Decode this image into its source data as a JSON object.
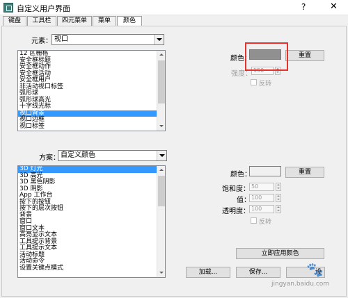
{
  "window": {
    "title": "自定义用户界面",
    "help": "?",
    "close": "✕"
  },
  "tabs": [
    "键盘",
    "工具栏",
    "四元菜单",
    "菜单",
    "颜色"
  ],
  "element_section": {
    "label": "元素：",
    "selected": "视口",
    "list": [
      "12 区栅格",
      "安全框标题",
      "安全框动作",
      "安全框活动",
      "安全框用户",
      "非活动视口标签",
      "弧形球",
      "弧形球高光",
      "十字线光标",
      "视口背景",
      "视口边框",
      "视口标签"
    ],
    "selected_item": "视口背景"
  },
  "right_top": {
    "color_label": "颜色：",
    "swatch_color": "#909090",
    "reset_label": "重置",
    "intensity_label": "强度：",
    "intensity_value": "150",
    "invert_label": "反转"
  },
  "scheme_section": {
    "label": "方案：",
    "selected": "自定义颜色",
    "list": [
      "3D 灯光",
      "3D 高光",
      "3D 黑色阴影",
      "3D 阴影",
      "App 工作台",
      "按下的按钮",
      "按下的层次按钮",
      "背景",
      "窗口",
      "窗口文本",
      "高亮显示文本",
      "工具提示背景",
      "工具提示文本",
      "活动标题",
      "活动命令",
      "设置关键点模式"
    ],
    "selected_item": "3D 灯光"
  },
  "right_bottom": {
    "color_label": "颜色：",
    "swatch_color": "#f0f0f0",
    "reset_label": "重置",
    "saturation_label": "饱和度：",
    "saturation_value": "50",
    "value_label": "值：",
    "value_value": "100",
    "transparency_label": "透明度：",
    "transparency_value": "100",
    "invert_label": "反转",
    "apply_label": "立即应用颜色"
  },
  "footer": {
    "load_label": "加载...",
    "save_label": "保存...",
    "extra_label": "设"
  },
  "watermark": {
    "url": "jingyan.baidu.com",
    "icon": "paw-icon"
  }
}
